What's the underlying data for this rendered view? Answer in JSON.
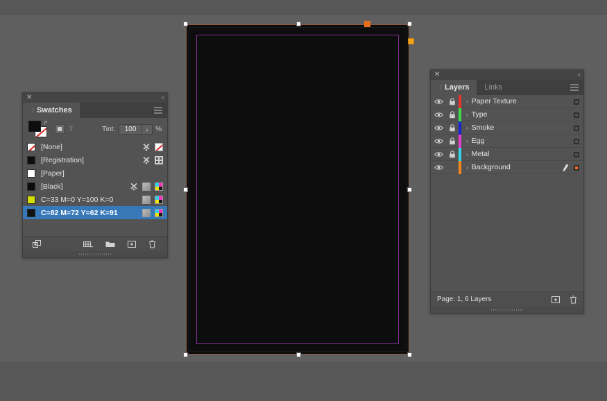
{
  "app": {
    "workspace_bg": "#5f5f5f",
    "band_bg": "#575757"
  },
  "document": {
    "page_fill": "#0d0d0d",
    "page_border_color": "#8a5a44",
    "margin_guide_color": "#7d2f8a",
    "selection_handle_color": "#ffffff",
    "anchor_orange_color": "#e8701a",
    "anchor_yellow_color": "#f0a31b"
  },
  "swatches_panel": {
    "close_glyph": "✕",
    "collapse_glyph": "«",
    "tab_grip_glyph": "⋮",
    "tabs": [
      {
        "label": "Swatches",
        "active": true
      }
    ],
    "menu_icon": "hamburger-menu-icon",
    "fill_color": "#0d0d0d",
    "stroke_color": "#ffffff",
    "stroke_is_none": true,
    "swap_glyph": "↱",
    "formatting_container_icon": "formatting-affects-container-icon",
    "formatting_text_icon": "T",
    "tint": {
      "label": "Tint:",
      "value": "100",
      "arrow_glyph": "›",
      "unit": "%"
    },
    "swatches": [
      {
        "name": "[None]",
        "chip": "#ffffff",
        "chip_none": true,
        "selected": false,
        "icons": [
          "tool",
          "none"
        ]
      },
      {
        "name": "[Registration]",
        "chip": "#0d0d0d",
        "chip_none": false,
        "selected": false,
        "icons": [
          "tool",
          "registration"
        ]
      },
      {
        "name": "[Paper]",
        "chip": "#ffffff",
        "chip_none": false,
        "selected": false,
        "icons": []
      },
      {
        "name": "[Black]",
        "chip": "#0d0d0d",
        "chip_none": false,
        "selected": false,
        "icons": [
          "tool",
          "gradient",
          "cmyk"
        ]
      },
      {
        "name": "C=33 M=0 Y=100 K=0",
        "chip": "#d6e000",
        "chip_none": false,
        "selected": false,
        "icons": [
          "gradient",
          "cmyk"
        ]
      },
      {
        "name": "C=82 M=72 Y=62 K=91",
        "chip": "#111111",
        "chip_none": false,
        "selected": true,
        "icons": [
          "gradient",
          "cmyk"
        ]
      }
    ],
    "selected_row_color": "#3778b9",
    "footer_icons": [
      "show-swatch-groups-icon",
      "new-color-group-icon",
      "new-swatch-folder-icon",
      "new-swatch-icon",
      "delete-swatch-icon"
    ]
  },
  "layers_panel": {
    "close_glyph": "✕",
    "collapse_glyph": "«",
    "tab_grip_glyph": "⋮",
    "tabs": [
      {
        "label": "Layers",
        "active": true
      },
      {
        "label": "Links",
        "active": false
      }
    ],
    "menu_icon": "hamburger-menu-icon",
    "disclosure_glyph": "›",
    "layers": [
      {
        "name": "Paper Texture",
        "color": "#e8352b",
        "visible": true,
        "locked": true,
        "targeted": false,
        "has_pen": false
      },
      {
        "name": "Type",
        "color": "#3ddc4a",
        "visible": true,
        "locked": true,
        "targeted": false,
        "has_pen": false
      },
      {
        "name": "Smoke",
        "color": "#1a23d8",
        "visible": true,
        "locked": true,
        "targeted": false,
        "has_pen": false
      },
      {
        "name": "Egg",
        "color": "#e63fd0",
        "visible": true,
        "locked": true,
        "targeted": false,
        "has_pen": false
      },
      {
        "name": "Metal",
        "color": "#33d6e8",
        "visible": true,
        "locked": true,
        "targeted": false,
        "has_pen": false
      },
      {
        "name": "Background",
        "color": "#f2871b",
        "visible": true,
        "locked": false,
        "targeted": true,
        "has_pen": true
      }
    ],
    "status": "Page: 1, 6 Layers",
    "footer_icons": [
      "new-layer-icon",
      "delete-layer-icon"
    ]
  }
}
